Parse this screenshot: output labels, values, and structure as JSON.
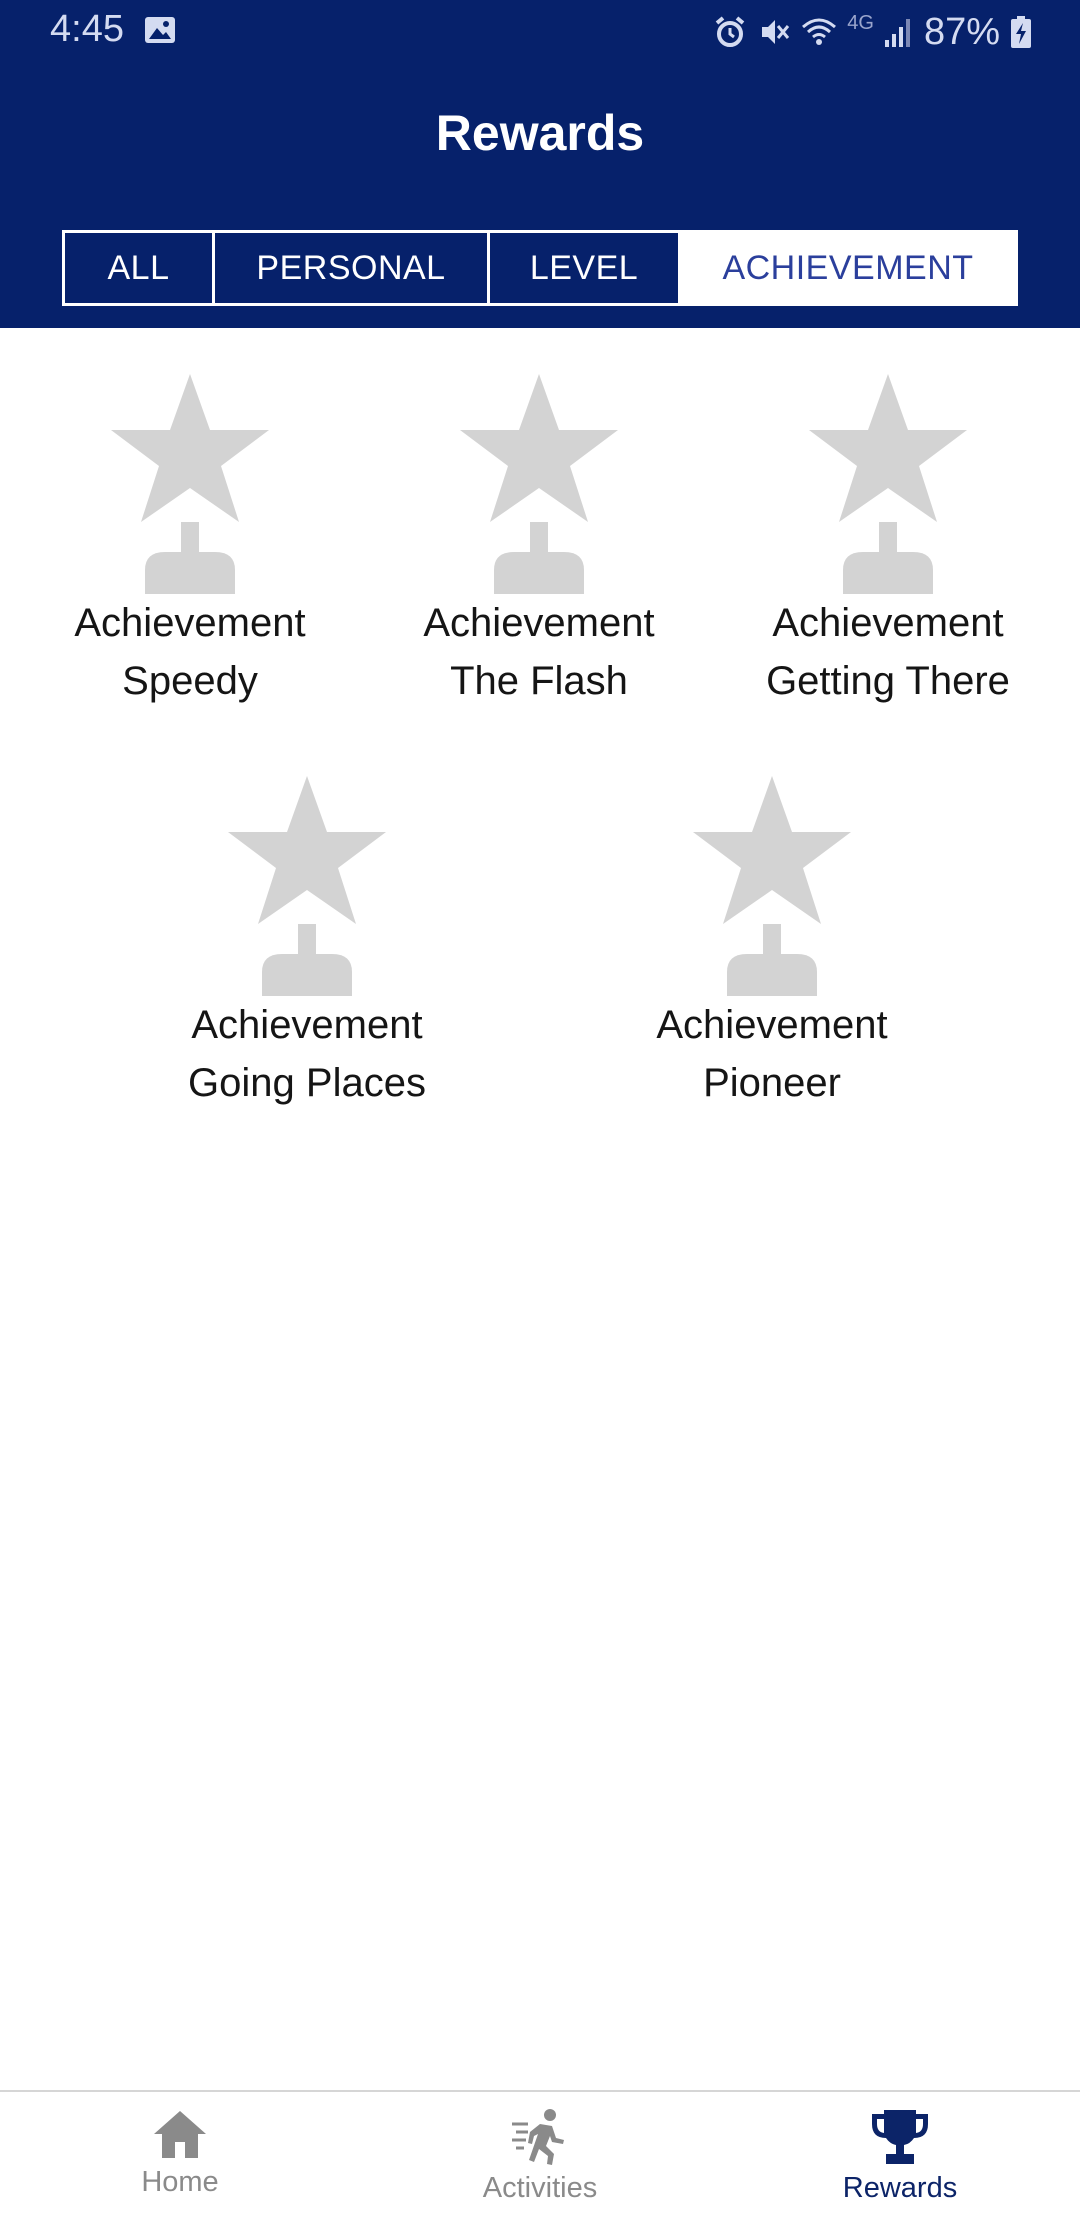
{
  "status_bar": {
    "time": "4:45",
    "network": "4G",
    "battery": "87%",
    "icons": [
      "image-icon",
      "alarm-icon",
      "mute-icon",
      "wifi-icon",
      "signal-icon",
      "battery-charging-icon"
    ]
  },
  "header": {
    "title": "Rewards",
    "background": "#06216b"
  },
  "tabs": [
    {
      "label": "ALL",
      "active": false
    },
    {
      "label": "PERSONAL",
      "active": false
    },
    {
      "label": "LEVEL",
      "active": false
    },
    {
      "label": "ACHIEVEMENT",
      "active": true
    }
  ],
  "awards": [
    {
      "line1": "Achievement",
      "line2": "Speedy",
      "icon": "trophy-star-icon"
    },
    {
      "line1": "Achievement",
      "line2": "The Flash",
      "icon": "trophy-star-icon"
    },
    {
      "line1": "Achievement",
      "line2": "Getting There",
      "icon": "trophy-star-icon"
    },
    {
      "line1": "Achievement",
      "line2": "Going Places",
      "icon": "trophy-star-icon"
    },
    {
      "line1": "Achievement",
      "line2": "Pioneer",
      "icon": "trophy-star-icon"
    }
  ],
  "bottom_nav": [
    {
      "label": "Home",
      "icon": "home-icon",
      "active": false
    },
    {
      "label": "Activities",
      "icon": "running-icon",
      "active": false
    },
    {
      "label": "Rewards",
      "icon": "trophy-icon",
      "active": true
    }
  ],
  "colors": {
    "accent": "#06216b",
    "active_tab_text": "#2b3f9c",
    "award_icon": "#d3d3d3",
    "nav_inactive": "#8a8a8a"
  }
}
